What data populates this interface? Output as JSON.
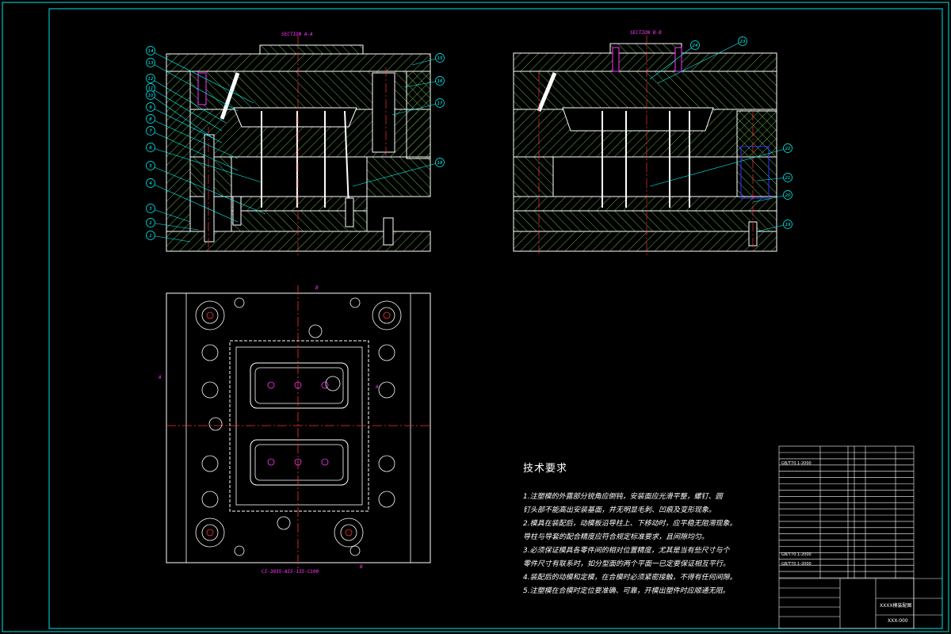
{
  "sheet": {
    "border_color": "#00e5e5",
    "background": "#000000",
    "line_color_hatch": "#66b34d",
    "line_color_parts": "#ffffff",
    "leader_color": "#00ffff",
    "centerline_color": "#ff3333",
    "annotation_color": "#ff33ff"
  },
  "views": {
    "section_a_title": "SECTION A-A",
    "section_b_title": "SECTION B-B",
    "plan_caption": "CI-3035-A55-135-C100",
    "plan_markers": [
      "A",
      "A",
      "B",
      "B"
    ]
  },
  "balloons_left": [
    "14",
    "13",
    "12",
    "11",
    "10",
    "9",
    "8",
    "7",
    "6",
    "5",
    "4",
    "3",
    "2",
    "1",
    "15",
    "16",
    "17",
    "18"
  ],
  "balloons_right": [
    "24",
    "23",
    "22",
    "21",
    "20",
    "19"
  ],
  "technical_requirements": {
    "heading": "技术要求",
    "items": [
      "1.注塑模的外露部分锐角应倒钝，安装面应光滑平整，螺钉、圆",
      "    钉头部不能高出安装基面，并无明显毛刺、凹痕及变形现象。",
      "2.模具在装配后，动模板沿导柱上、下移动时，应平稳无阻滞现象。",
      "    导柱与导套的配合精度应符合规定标准要求，且间隙均匀。",
      "3.必须保证模具各零件间的相对位置精度，尤其是当有些尺寸与个",
      "    零件尺寸有联系时，如分型面的两个平面一已定要保证相互平行。",
      "4.装配后的动模和定模，在合模时必须紧密接触，不得有任何间隙。",
      "5.注塑模在合模时定位要准确、可靠，开模出塑件时应顺通无阻。"
    ]
  },
  "title_block": {
    "drawing_name": "XXXX模装配图",
    "drawing_no": "XXX-000",
    "std_part_1": "GB/T70.1-2000",
    "std_part_2": "GB/T70.1-2000",
    "std_part_3": "GB/T70.1-2000"
  }
}
